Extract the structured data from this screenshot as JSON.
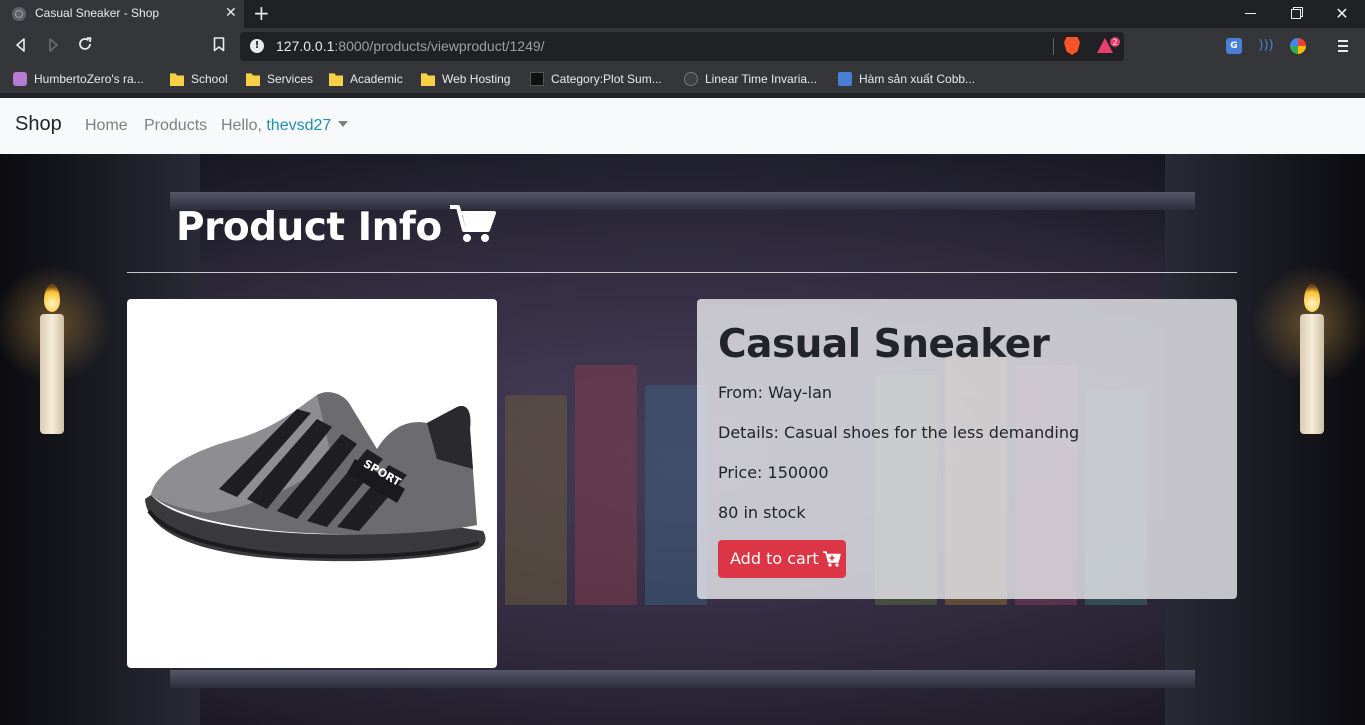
{
  "browser": {
    "tab_title": "Casual Sneaker - Shop",
    "url_host": "127.0.0.1",
    "url_rest": ":8000/products/viewproduct/1249/",
    "rewards_badge": "2",
    "translate_label": "G"
  },
  "bookmarks": [
    {
      "label": "HumbertoZero's ra...",
      "icon": "avatar-icon"
    },
    {
      "label": "School",
      "icon": "folder-icon"
    },
    {
      "label": "Services",
      "icon": "folder-icon"
    },
    {
      "label": "Academic",
      "icon": "folder-icon"
    },
    {
      "label": "Web Hosting",
      "icon": "folder-icon"
    },
    {
      "label": "Category:Plot Sum...",
      "icon": "wiki-icon"
    },
    {
      "label": "Linear Time Invaria...",
      "icon": "globe-icon"
    },
    {
      "label": "Hàm sản xuất Cobb...",
      "icon": "doc-icon"
    }
  ],
  "navbar": {
    "brand": "Shop",
    "home": "Home",
    "products": "Products",
    "hello_prefix": "Hello, ",
    "username": "thevsd27"
  },
  "page": {
    "title": "Product Info"
  },
  "product": {
    "name": "Casual Sneaker",
    "from": "From: Way-lan",
    "details": "Details: Casual shoes for the less demanding",
    "price": "Price: 150000",
    "stock": "80 in stock",
    "add_to_cart": "Add to cart",
    "image_text": "SPORT"
  },
  "colors": {
    "navbar_bg": "#f8f9fa",
    "username_link": "#1f8fae",
    "button_danger": "#dc3545"
  }
}
